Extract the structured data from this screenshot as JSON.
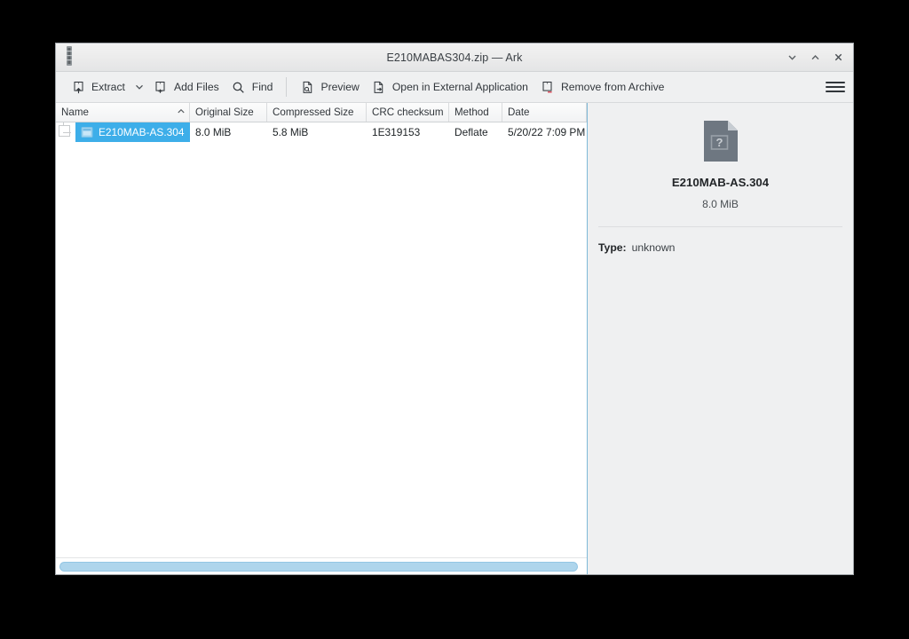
{
  "window": {
    "title": "E210MABAS304.zip — Ark",
    "app_icon": "ark-icon",
    "controls": [
      {
        "name": "minimize-button",
        "icon": "chevron-down-icon",
        "label": "Minimize"
      },
      {
        "name": "maximize-button",
        "icon": "chevron-up-icon",
        "label": "Maximize"
      },
      {
        "name": "close-button",
        "icon": "close-icon",
        "label": "Close"
      }
    ]
  },
  "toolbar": {
    "extract_label": "Extract",
    "extract_icon": "archive-extract-icon",
    "extract_dropdown_icon": "chevron-down-icon",
    "add_files_label": "Add Files",
    "add_files_icon": "archive-add-icon",
    "find_label": "Find",
    "find_icon": "search-icon",
    "preview_label": "Preview",
    "preview_icon": "document-preview-icon",
    "open_external_label": "Open in External Application",
    "open_external_icon": "document-open-external-icon",
    "remove_label": "Remove from Archive",
    "remove_icon": "archive-remove-icon",
    "menu_label": "Menu",
    "menu_icon": "hamburger-menu-icon"
  },
  "file_list": {
    "columns": [
      {
        "label": "Name",
        "sorted": true,
        "sort_icon": "sort-ascending-icon"
      },
      {
        "label": "Original Size",
        "sorted": false
      },
      {
        "label": "Compressed Size",
        "sorted": false
      },
      {
        "label": "CRC checksum",
        "sorted": false
      },
      {
        "label": "Method",
        "sorted": false
      },
      {
        "label": "Date",
        "sorted": false
      }
    ],
    "rows": [
      {
        "name": "E210MAB-AS.304",
        "original_size": "8.0 MiB",
        "compressed_size": "5.8 MiB",
        "crc": "1E319153",
        "method": "Deflate",
        "date": "5/20/22 7:09 PM",
        "selected": true,
        "icon": "file-icon"
      }
    ],
    "scrollbar": {
      "name": "horizontal-scrollbar",
      "thumb_percent": 99
    }
  },
  "info_panel": {
    "icon": "unknown-file-type-icon",
    "name": "E210MAB-AS.304",
    "size": "8.0 MiB",
    "type_key": "Type:",
    "type_value": "unknown"
  },
  "colors": {
    "selection": "#3daee9",
    "window_bg": "#eff0f1",
    "list_bg": "#ffffff",
    "text": "#31363b",
    "scrollbar_thumb": "#aed5ec",
    "desktop": "#000000"
  }
}
